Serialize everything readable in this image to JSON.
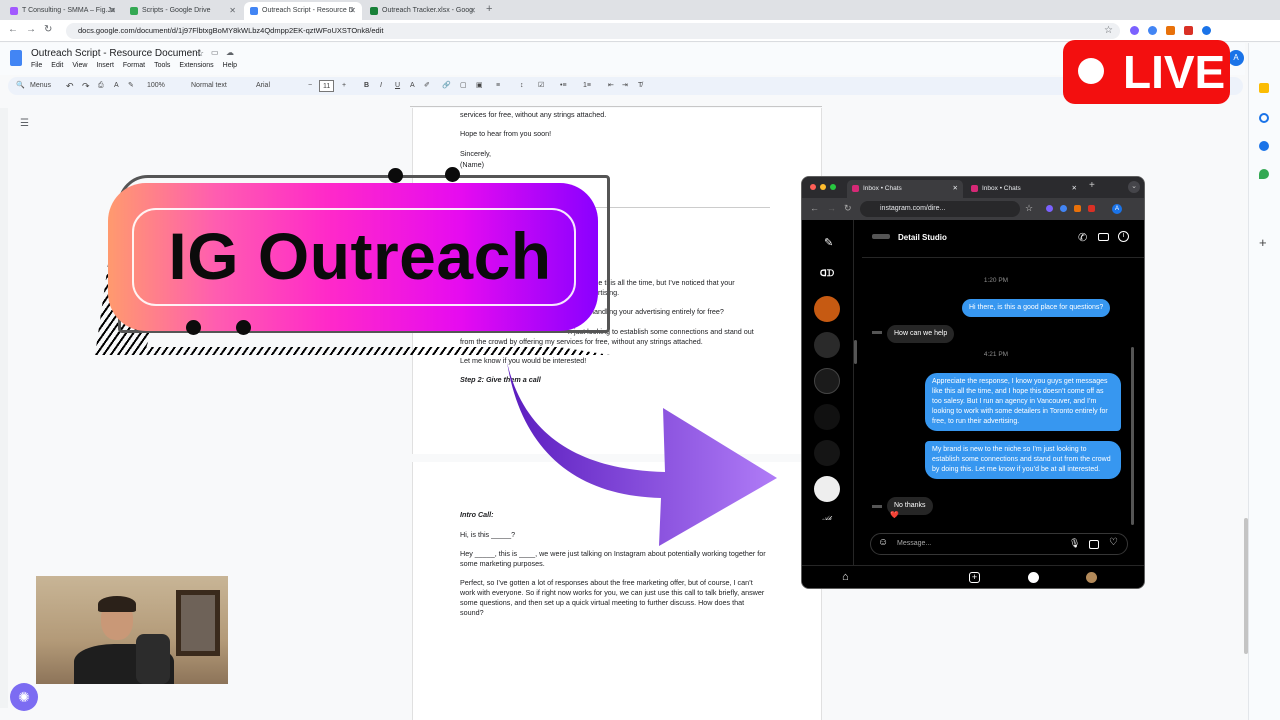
{
  "browser": {
    "tabs": [
      {
        "label": "T Consulting - SMMA – Fig.Ja",
        "color": "#a259ff"
      },
      {
        "label": "Scripts - Google Drive",
        "color": "#34a853"
      },
      {
        "label": "Outreach Script - Resource D",
        "color": "#4285f4"
      },
      {
        "label": "Outreach Tracker.xlsx - Goog",
        "color": "#188038"
      }
    ],
    "url": "docs.google.com/document/d/1j97FlbtxgBoMY8kWLbz4Qdmpp2EK-qztWFoUXSTOnk8/edit"
  },
  "doc": {
    "title": "Outreach Script - Resource Document",
    "menu": [
      "File",
      "Edit",
      "View",
      "Insert",
      "Format",
      "Tools",
      "Extensions",
      "Help"
    ],
    "toolbar": {
      "menus": "Menus",
      "zoom": "100%",
      "style": "Normal text",
      "font": "Arial",
      "size": "11"
    },
    "page1": {
      "line1": "services for free, without any strings attached.",
      "line2": "Hope to hear from you soon!",
      "line3": "Sincerely,",
      "line4": "(Name)",
      "p_a1": "ages like this all the time, but I’ve noticed that your",
      "p_a2": "rtising.",
      "p_b": "m handling your advertising entirely for free?",
      "p_c1": "n just looking to establish some connections and stand out",
      "p_c2": "from the crowd by offering my services for free, without any strings attached.",
      "p_d": "Let me know if you would be interested!",
      "step2": "Step 2: Give them a call"
    },
    "page2": {
      "heading": "Intro Call:",
      "l1": "Hi, is this _____?",
      "l2a": "Hey _____, this is ____, we were just talking on Instagram about potentially working together for",
      "l2b": "some marketing purposes.",
      "l3a": "Perfect, so I’ve gotten a lot of responses about the free marketing offer, but of course, I can’t",
      "l3b": "work with everyone. So if right now works for you, we can just use this call to talk briefly, answer",
      "l3c": "some questions, and then set up a quick virtual meeting to further discuss. How does that",
      "l3d": "sound?"
    }
  },
  "overlay": {
    "banner": "IG Outreach",
    "live": "LIVE"
  },
  "instagram": {
    "tab1": "Inbox • Chats",
    "tab2": "Inbox • Chats",
    "url": "instagram.com/dire...",
    "contact": "Detail Studio",
    "time1": "1:20 PM",
    "msg_out1": "Hi there, is this a good place for questions?",
    "msg_in1": "How can we help",
    "time2": "4:21 PM",
    "msg_out2": "Appreciate the response,  I know you guys get messages like this all the time, and I hope this doesn’t come off as too salesy. But I run an agency in Vancouver, and I’m looking to work with some detailers in Toronto entirely for free, to run their advertising.",
    "msg_out3": "My brand is new to the niche so I’m just looking to establish some connections and stand out from the crowd by doing this. Let me know if you’d be at all interested.",
    "msg_in2": "No thanks",
    "reaction": "❤️",
    "composer_placeholder": "Message..."
  },
  "colors": {
    "accent": "#3797f0",
    "live": "#f30f0f",
    "arrow": "#8f4be8"
  }
}
